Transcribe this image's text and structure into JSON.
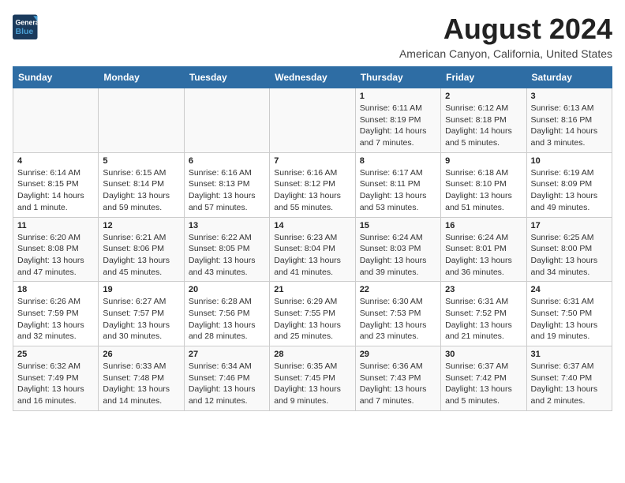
{
  "logo": {
    "line1": "General",
    "line2": "Blue"
  },
  "title": "August 2024",
  "subtitle": "American Canyon, California, United States",
  "header_color": "#2e6da4",
  "days_of_week": [
    "Sunday",
    "Monday",
    "Tuesday",
    "Wednesday",
    "Thursday",
    "Friday",
    "Saturday"
  ],
  "weeks": [
    [
      {
        "num": "",
        "info": ""
      },
      {
        "num": "",
        "info": ""
      },
      {
        "num": "",
        "info": ""
      },
      {
        "num": "",
        "info": ""
      },
      {
        "num": "1",
        "info": "Sunrise: 6:11 AM\nSunset: 8:19 PM\nDaylight: 14 hours\nand 7 minutes."
      },
      {
        "num": "2",
        "info": "Sunrise: 6:12 AM\nSunset: 8:18 PM\nDaylight: 14 hours\nand 5 minutes."
      },
      {
        "num": "3",
        "info": "Sunrise: 6:13 AM\nSunset: 8:16 PM\nDaylight: 14 hours\nand 3 minutes."
      }
    ],
    [
      {
        "num": "4",
        "info": "Sunrise: 6:14 AM\nSunset: 8:15 PM\nDaylight: 14 hours\nand 1 minute."
      },
      {
        "num": "5",
        "info": "Sunrise: 6:15 AM\nSunset: 8:14 PM\nDaylight: 13 hours\nand 59 minutes."
      },
      {
        "num": "6",
        "info": "Sunrise: 6:16 AM\nSunset: 8:13 PM\nDaylight: 13 hours\nand 57 minutes."
      },
      {
        "num": "7",
        "info": "Sunrise: 6:16 AM\nSunset: 8:12 PM\nDaylight: 13 hours\nand 55 minutes."
      },
      {
        "num": "8",
        "info": "Sunrise: 6:17 AM\nSunset: 8:11 PM\nDaylight: 13 hours\nand 53 minutes."
      },
      {
        "num": "9",
        "info": "Sunrise: 6:18 AM\nSunset: 8:10 PM\nDaylight: 13 hours\nand 51 minutes."
      },
      {
        "num": "10",
        "info": "Sunrise: 6:19 AM\nSunset: 8:09 PM\nDaylight: 13 hours\nand 49 minutes."
      }
    ],
    [
      {
        "num": "11",
        "info": "Sunrise: 6:20 AM\nSunset: 8:08 PM\nDaylight: 13 hours\nand 47 minutes."
      },
      {
        "num": "12",
        "info": "Sunrise: 6:21 AM\nSunset: 8:06 PM\nDaylight: 13 hours\nand 45 minutes."
      },
      {
        "num": "13",
        "info": "Sunrise: 6:22 AM\nSunset: 8:05 PM\nDaylight: 13 hours\nand 43 minutes."
      },
      {
        "num": "14",
        "info": "Sunrise: 6:23 AM\nSunset: 8:04 PM\nDaylight: 13 hours\nand 41 minutes."
      },
      {
        "num": "15",
        "info": "Sunrise: 6:24 AM\nSunset: 8:03 PM\nDaylight: 13 hours\nand 39 minutes."
      },
      {
        "num": "16",
        "info": "Sunrise: 6:24 AM\nSunset: 8:01 PM\nDaylight: 13 hours\nand 36 minutes."
      },
      {
        "num": "17",
        "info": "Sunrise: 6:25 AM\nSunset: 8:00 PM\nDaylight: 13 hours\nand 34 minutes."
      }
    ],
    [
      {
        "num": "18",
        "info": "Sunrise: 6:26 AM\nSunset: 7:59 PM\nDaylight: 13 hours\nand 32 minutes."
      },
      {
        "num": "19",
        "info": "Sunrise: 6:27 AM\nSunset: 7:57 PM\nDaylight: 13 hours\nand 30 minutes."
      },
      {
        "num": "20",
        "info": "Sunrise: 6:28 AM\nSunset: 7:56 PM\nDaylight: 13 hours\nand 28 minutes."
      },
      {
        "num": "21",
        "info": "Sunrise: 6:29 AM\nSunset: 7:55 PM\nDaylight: 13 hours\nand 25 minutes."
      },
      {
        "num": "22",
        "info": "Sunrise: 6:30 AM\nSunset: 7:53 PM\nDaylight: 13 hours\nand 23 minutes."
      },
      {
        "num": "23",
        "info": "Sunrise: 6:31 AM\nSunset: 7:52 PM\nDaylight: 13 hours\nand 21 minutes."
      },
      {
        "num": "24",
        "info": "Sunrise: 6:31 AM\nSunset: 7:50 PM\nDaylight: 13 hours\nand 19 minutes."
      }
    ],
    [
      {
        "num": "25",
        "info": "Sunrise: 6:32 AM\nSunset: 7:49 PM\nDaylight: 13 hours\nand 16 minutes."
      },
      {
        "num": "26",
        "info": "Sunrise: 6:33 AM\nSunset: 7:48 PM\nDaylight: 13 hours\nand 14 minutes."
      },
      {
        "num": "27",
        "info": "Sunrise: 6:34 AM\nSunset: 7:46 PM\nDaylight: 13 hours\nand 12 minutes."
      },
      {
        "num": "28",
        "info": "Sunrise: 6:35 AM\nSunset: 7:45 PM\nDaylight: 13 hours\nand 9 minutes."
      },
      {
        "num": "29",
        "info": "Sunrise: 6:36 AM\nSunset: 7:43 PM\nDaylight: 13 hours\nand 7 minutes."
      },
      {
        "num": "30",
        "info": "Sunrise: 6:37 AM\nSunset: 7:42 PM\nDaylight: 13 hours\nand 5 minutes."
      },
      {
        "num": "31",
        "info": "Sunrise: 6:37 AM\nSunset: 7:40 PM\nDaylight: 13 hours\nand 2 minutes."
      }
    ]
  ]
}
